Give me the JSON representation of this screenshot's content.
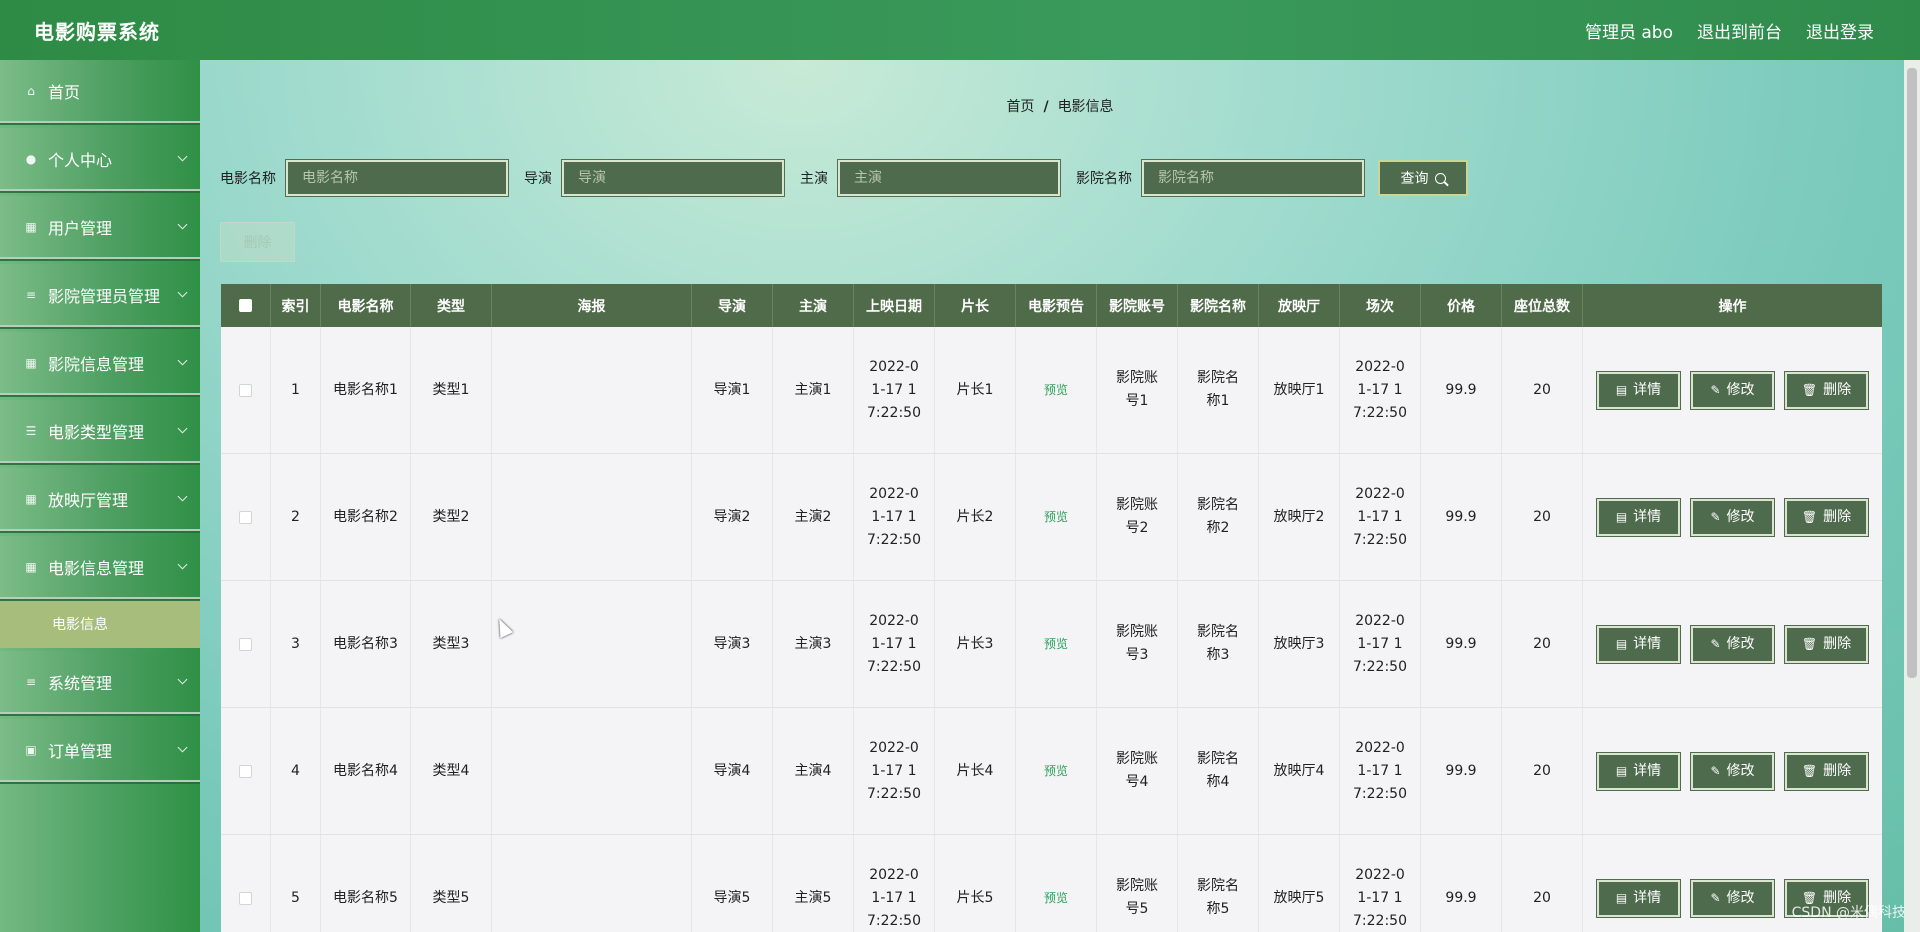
{
  "header": {
    "brand": "电影购票系统",
    "admin": "管理员 abo",
    "to_front": "退出到前台",
    "logout": "退出登录"
  },
  "sidebar": {
    "items": [
      {
        "label": "首页",
        "icon": "home-icon",
        "chevron": false
      },
      {
        "label": "个人中心",
        "icon": "user-icon",
        "chevron": true
      },
      {
        "label": "用户管理",
        "icon": "grid-icon",
        "chevron": true
      },
      {
        "label": "影院管理员管理",
        "icon": "menu-icon",
        "chevron": true
      },
      {
        "label": "影院信息管理",
        "icon": "grid-icon",
        "chevron": true
      },
      {
        "label": "电影类型管理",
        "icon": "sliders-icon",
        "chevron": true
      },
      {
        "label": "放映厅管理",
        "icon": "grid-icon",
        "chevron": true
      },
      {
        "label": "电影信息管理",
        "icon": "grid-icon",
        "chevron": true
      },
      {
        "label": "系统管理",
        "icon": "menu-icon",
        "chevron": true
      },
      {
        "label": "订单管理",
        "icon": "clipboard-icon",
        "chevron": true
      }
    ],
    "submenu": {
      "label": "电影信息"
    }
  },
  "breadcrumb": {
    "home": "首页",
    "sep": "/",
    "current": "电影信息"
  },
  "search": {
    "movie_name_label": "电影名称",
    "movie_name_placeholder": "电影名称",
    "director_label": "导演",
    "director_placeholder": "导演",
    "actor_label": "主演",
    "actor_placeholder": "主演",
    "cinema_label": "影院名称",
    "cinema_placeholder": "影院名称",
    "query_label": "查询"
  },
  "batch_delete_label": "删除",
  "table": {
    "headers": [
      "",
      "索引",
      "电影名称",
      "类型",
      "海报",
      "导演",
      "主演",
      "上映日期",
      "片长",
      "电影预告",
      "影院账号",
      "影院名称",
      "放映厅",
      "场次",
      "价格",
      "座位总数",
      "操作"
    ],
    "rows": [
      {
        "index": "1",
        "name": "电影名称1",
        "type": "类型1",
        "director": "导演1",
        "actor": "主演1",
        "date": "2022-01-17 17:22:50",
        "duration": "片长1",
        "trailer": "预览",
        "account": "影院账号1",
        "cinema": "影院名称1",
        "hall": "放映厅1",
        "session": "2022-01-17 17:22:50",
        "price": "99.9",
        "seats": "20"
      },
      {
        "index": "2",
        "name": "电影名称2",
        "type": "类型2",
        "director": "导演2",
        "actor": "主演2",
        "date": "2022-01-17 17:22:50",
        "duration": "片长2",
        "trailer": "预览",
        "account": "影院账号2",
        "cinema": "影院名称2",
        "hall": "放映厅2",
        "session": "2022-01-17 17:22:50",
        "price": "99.9",
        "seats": "20"
      },
      {
        "index": "3",
        "name": "电影名称3",
        "type": "类型3",
        "director": "导演3",
        "actor": "主演3",
        "date": "2022-01-17 17:22:50",
        "duration": "片长3",
        "trailer": "预览",
        "account": "影院账号3",
        "cinema": "影院名称3",
        "hall": "放映厅3",
        "session": "2022-01-17 17:22:50",
        "price": "99.9",
        "seats": "20"
      },
      {
        "index": "4",
        "name": "电影名称4",
        "type": "类型4",
        "director": "导演4",
        "actor": "主演4",
        "date": "2022-01-17 17:22:50",
        "duration": "片长4",
        "trailer": "预览",
        "account": "影院账号4",
        "cinema": "影院名称4",
        "hall": "放映厅4",
        "session": "2022-01-17 17:22:50",
        "price": "99.9",
        "seats": "20"
      },
      {
        "index": "5",
        "name": "电影名称5",
        "type": "类型5",
        "director": "导演5",
        "actor": "主演5",
        "date": "2022-01-17 17:22:50",
        "duration": "片长5",
        "trailer": "预览",
        "account": "影院账号5",
        "cinema": "影院名称5",
        "hall": "放映厅5",
        "session": "2022-01-17 17:22:50",
        "price": "99.9",
        "seats": "20"
      }
    ],
    "actions": {
      "detail": "详情",
      "edit": "修改",
      "delete": "删除"
    }
  },
  "watermark": "CSDN @米偶科技"
}
